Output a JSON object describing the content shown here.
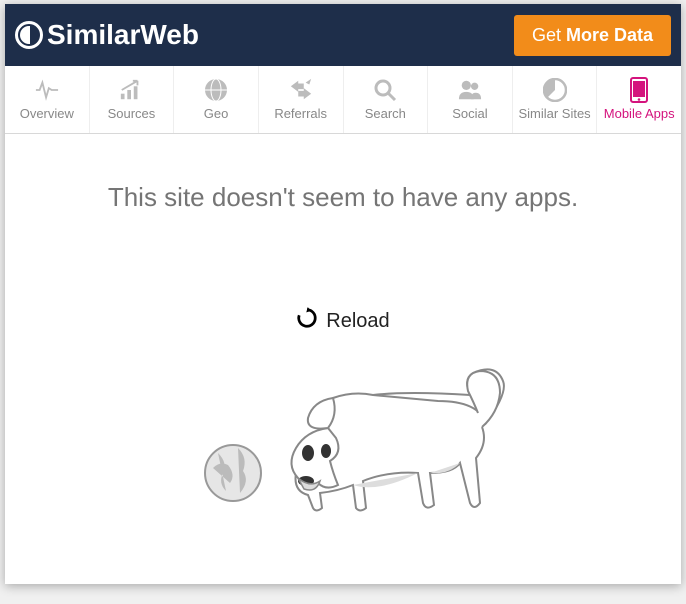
{
  "brand": "SimilarWeb",
  "cta": {
    "prefix": "Get",
    "bold": "More Data"
  },
  "tabs": [
    {
      "label": "Overview"
    },
    {
      "label": "Sources"
    },
    {
      "label": "Geo"
    },
    {
      "label": "Referrals"
    },
    {
      "label": "Search"
    },
    {
      "label": "Social"
    },
    {
      "label": "Similar Sites"
    },
    {
      "label": "Mobile Apps"
    }
  ],
  "active_tab_index": 7,
  "empty_message": "This site doesn't seem to have any apps.",
  "reload_label": "Reload"
}
